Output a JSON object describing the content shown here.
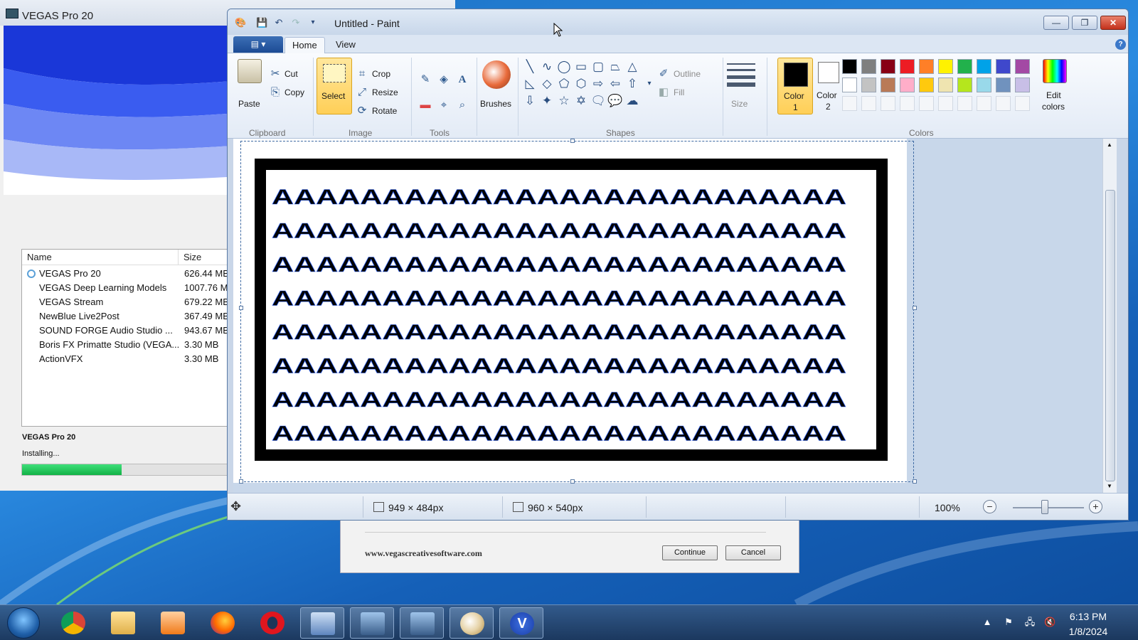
{
  "vegas": {
    "title": "VEGAS Pro 20",
    "columns": [
      "Name",
      "Size"
    ],
    "items": [
      {
        "name": "VEGAS Pro 20",
        "size": "626.44 MB"
      },
      {
        "name": "VEGAS Deep Learning Models",
        "size": "1007.76 MB"
      },
      {
        "name": "VEGAS Stream",
        "size": "679.22 MB"
      },
      {
        "name": "NewBlue Live2Post",
        "size": "367.49 MB"
      },
      {
        "name": "SOUND FORGE Audio Studio ...",
        "size": "943.67 MB"
      },
      {
        "name": "Boris FX Primatte Studio (VEGA...",
        "size": "3.30 MB"
      },
      {
        "name": "ActionVFX",
        "size": "3.30 MB"
      }
    ],
    "product": "VEGAS Pro 20",
    "status": "Installing...",
    "progress_fraction": 0.47
  },
  "dialog": {
    "url": "www.vegascreativesoftware.com",
    "continue_label": "Continue",
    "cancel_label": "Cancel"
  },
  "paint": {
    "title": "Untitled - Paint",
    "tabs": {
      "home": "Home",
      "view": "View"
    },
    "ribbon": {
      "paste": "Paste",
      "cut": "Cut",
      "copy": "Copy",
      "clipboard_group": "Clipboard",
      "select": "Select",
      "crop": "Crop",
      "resize": "Resize",
      "rotate": "Rotate",
      "image_group": "Image",
      "tools_group": "Tools",
      "brushes": "Brushes",
      "shapes_group": "Shapes",
      "outline": "Outline",
      "fill": "Fill",
      "size": "Size",
      "color1": "Color",
      "color1_num": "1",
      "color2": "Color",
      "color2_num": "2",
      "edit_colors": "Edit",
      "edit_colors2": "colors",
      "colors_group": "Colors"
    },
    "palette_row1": [
      "#000000",
      "#7f7f7f",
      "#880015",
      "#ed1c24",
      "#ff7f27",
      "#fff200",
      "#22b14c",
      "#00a2e8",
      "#3f48cc",
      "#a349a4"
    ],
    "palette_row2": [
      "#ffffff",
      "#c3c3c3",
      "#b97a57",
      "#ffaec9",
      "#ffc90e",
      "#efe4b0",
      "#b5e61d",
      "#99d9ea",
      "#7092be",
      "#c8bfe7"
    ],
    "color1_value": "#000000",
    "color2_value": "#ffffff",
    "canvas_text_rows": [
      "AAAAAAAAAAAAAAAAAAAAAAAAAA",
      "AAAAAAAAAAAAAAAAAAAAAAAAAA",
      "AAAAAAAAAAAAAAAAAAAAAAAAAA",
      "AAAAAAAAAAAAAAAAAAAAAAAAAA",
      "AAAAAAAAAAAAAAAAAAAAAAAAAA",
      "AAAAAAAAAAAAAAAAAAAAAAAAAA",
      "AAAAAAAAAAAAAAAAAAAAAAAAAA",
      "AAAAAAAAAAAAAAAAAAAAAAAAAA"
    ],
    "status": {
      "selection_size": "949 × 484px",
      "image_size": "960 × 540px",
      "zoom": "100%"
    }
  },
  "taskbar": {
    "time": "6:13 PM",
    "date": "1/8/2024"
  }
}
